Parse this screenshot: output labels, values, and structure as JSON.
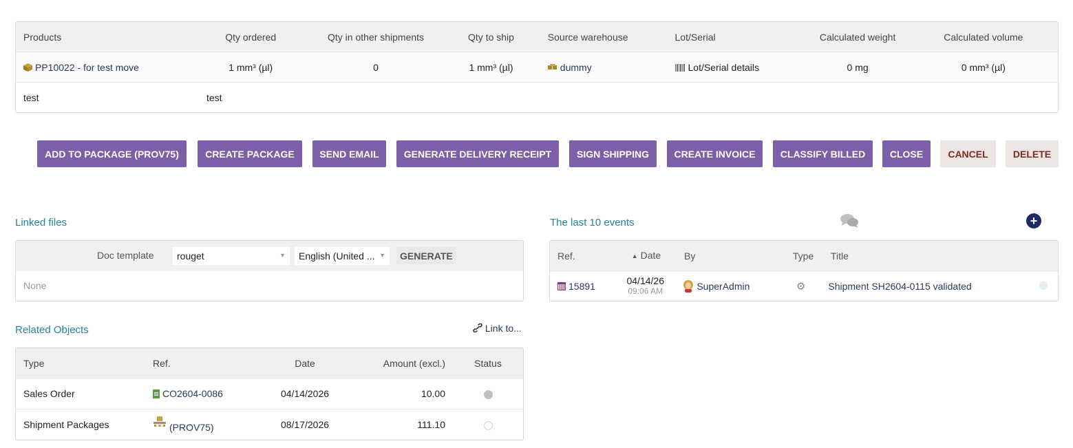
{
  "products_table": {
    "headers": {
      "products": "Products",
      "qty_ordered": "Qty ordered",
      "qty_other": "Qty in other shipments",
      "qty_to_ship": "Qty to ship",
      "source_warehouse": "Source warehouse",
      "lot_serial": "Lot/Serial",
      "calc_weight": "Calculated weight",
      "calc_volume": "Calculated volume"
    },
    "row": {
      "product": "PP10022 - for test move",
      "qty_ordered": "1 mm³ (µl)",
      "qty_other": "0",
      "qty_to_ship": "1 mm³ (µl)",
      "warehouse": "dummy",
      "lot_serial": "Lot/Serial details",
      "weight": "0 mg",
      "volume": "0 mm³ (µl)"
    },
    "row2": {
      "col1": "test",
      "col2": "test"
    }
  },
  "actions": {
    "add_to_package": "ADD TO PACKAGE (PROV75)",
    "create_package": "CREATE PACKAGE",
    "send_email": "SEND EMAIL",
    "generate_receipt": "GENERATE DELIVERY RECEIPT",
    "sign_shipping": "SIGN SHIPPING",
    "create_invoice": "CREATE INVOICE",
    "classify_billed": "CLASSIFY BILLED",
    "close": "CLOSE",
    "cancel": "CANCEL",
    "delete": "DELETE"
  },
  "linked_files": {
    "title": "Linked files",
    "doc_template_label": "Doc template",
    "template_value": "rouget",
    "language_value": "English (United ...",
    "generate_label": "GENERATE",
    "none_text": "None"
  },
  "related_objects": {
    "title": "Related Objects",
    "link_to": "Link to...",
    "headers": {
      "type": "Type",
      "ref": "Ref.",
      "date": "Date",
      "amount": "Amount (excl.)",
      "status": "Status"
    },
    "rows": [
      {
        "type": "Sales Order",
        "ref": "CO2604-0086",
        "date": "04/14/2026",
        "amount": "10.00"
      },
      {
        "type": "Shipment Packages",
        "ref": "(PROV75)",
        "date": "08/17/2026",
        "amount": "111.10"
      }
    ]
  },
  "events": {
    "title": "The last 10 events",
    "headers": {
      "ref": "Ref.",
      "date": "Date",
      "by": "By",
      "type": "Type",
      "title": "Title"
    },
    "row": {
      "ref": "15891",
      "date": "04/14/26",
      "time": "09:06 AM",
      "by": "SuperAdmin",
      "title": "Shipment SH2604-0115 validated"
    }
  },
  "colors": {
    "button_primary": "#7c5fa9",
    "button_light": "#ebe5e3",
    "section_title": "#21849b",
    "link": "#263c5c"
  }
}
